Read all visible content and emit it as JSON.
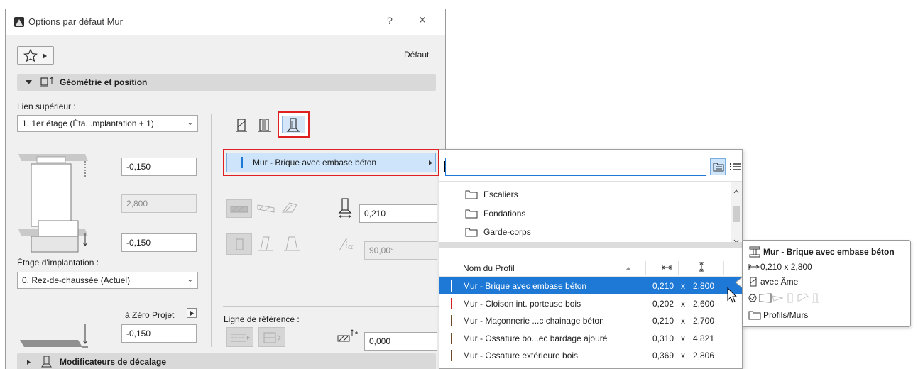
{
  "dialog": {
    "title": "Options par défaut Mur",
    "help_label": "?",
    "close_label": "×",
    "preset_label": "Défaut"
  },
  "geometry_section": {
    "title": "Géométrie et position",
    "top_link_label": "Lien supérieur :",
    "top_link_value": "1. 1er étage (Éta...mplantation + 1)",
    "top_offset": "-0,150",
    "height": "2,800",
    "base_offset": "-0,150",
    "home_story_label": "Étage d'implantation :",
    "home_story_value": "0. Rez-de-chaussée (Actuel)",
    "project_zero_label": "à Zéro Projet",
    "project_zero_value": "-0,150",
    "selected_profile": "Mur - Brique avec embase béton",
    "thickness": "0,210",
    "angle": "90,00°",
    "reference_line_label": "Ligne de référence :",
    "reference_offset": "0,000"
  },
  "offset_section": {
    "title": "Modificateurs de décalage"
  },
  "profile_popup": {
    "search_value": "",
    "folders": [
      "Escaliers",
      "Fondations",
      "Garde-corps"
    ],
    "columns": {
      "name": "Nom du Profil"
    },
    "rows": [
      {
        "name": "Mur - Brique avec embase béton",
        "width": "0,210",
        "x": "x",
        "height": "2,800",
        "color": "#1e79d6"
      },
      {
        "name": "Mur - Cloison int. porteuse bois",
        "width": "0,202",
        "x": "x",
        "height": "2,600",
        "color": "#d42020"
      },
      {
        "name": "Mur - Maçonnerie ...c chainage béton",
        "width": "0,210",
        "x": "x",
        "height": "2,700",
        "color": "#6b4a2a"
      },
      {
        "name": "Mur - Ossature bo...ec bardage ajouré",
        "width": "0,310",
        "x": "x",
        "height": "4,821",
        "color": "#6b4a2a"
      },
      {
        "name": "Mur - Ossature extérieure bois",
        "width": "0,369",
        "x": "x",
        "height": "2,806",
        "color": "#6b4a2a"
      }
    ]
  },
  "tooltip": {
    "title": "Mur - Brique avec embase béton",
    "dimensions": "0,210 x 2,800",
    "core": "avec Âme",
    "folder": "Profils/Murs"
  },
  "colors": {
    "accent": "#1e79d6",
    "highlight_border": "#e02020",
    "section_bar": "#d9d9d9"
  }
}
